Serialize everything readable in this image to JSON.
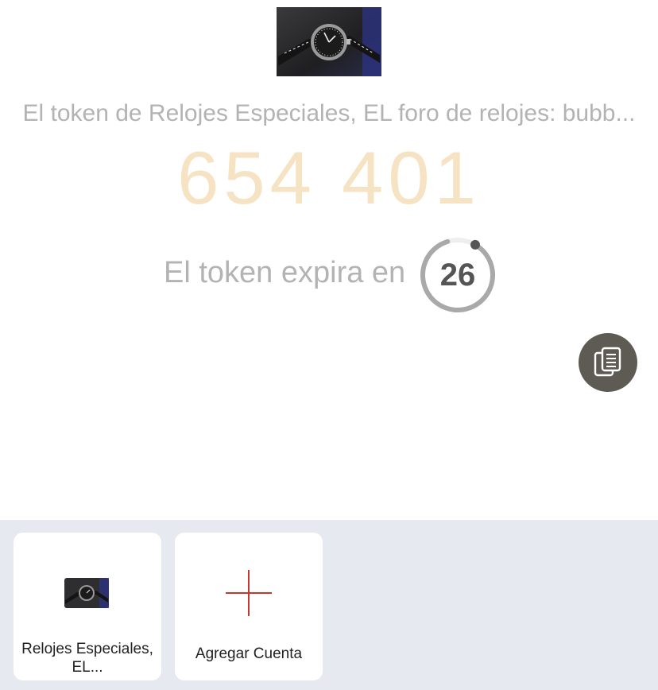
{
  "account": {
    "title": "El token de Relojes Especiales, EL foro de relojes: bubb...",
    "logo_icon": "wristwatch-photo"
  },
  "token": {
    "code": "654 401",
    "expiry_label": "El token expira en",
    "seconds_remaining": "26",
    "remaining_fraction": 0.87
  },
  "actions": {
    "copy_icon": "copy-icon"
  },
  "accounts_panel": {
    "items": [
      {
        "label": "Relojes Especiales, EL...",
        "icon": "wristwatch-photo"
      }
    ],
    "add_label": "Agregar Cuenta",
    "add_icon": "plus-icon"
  },
  "colors": {
    "token_code": "#f6e3c4",
    "muted_text": "#b3b3b3",
    "copy_button": "#5d5b54",
    "panel_bg": "#e6e9ef",
    "plus_accent": "#c8362f"
  }
}
